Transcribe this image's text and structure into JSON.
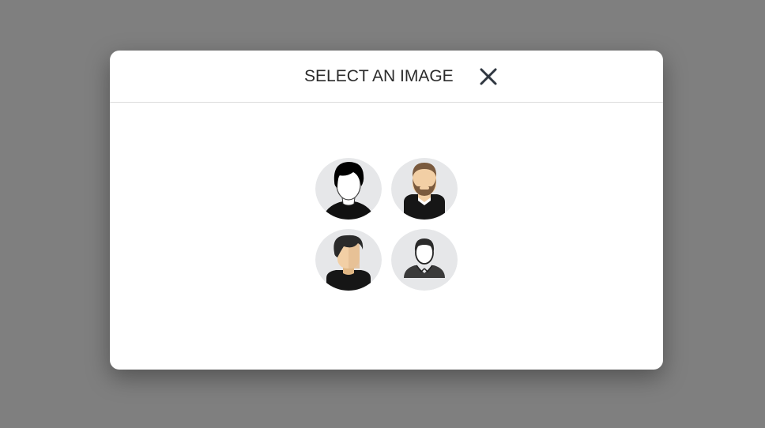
{
  "modal": {
    "title": "SELECT AN IMAGE",
    "close_icon": "close-icon"
  },
  "avatars": [
    {
      "icon": "avatar-man-black-hair-icon"
    },
    {
      "icon": "avatar-man-beard-icon"
    },
    {
      "icon": "avatar-man-fringe-icon"
    },
    {
      "icon": "avatar-man-outline-icon"
    }
  ],
  "colors": {
    "backdrop": "#7f7f7f",
    "modal_bg": "#ffffff",
    "avatar_bg": "#e6e7e9",
    "skin": "#f2cfa5",
    "dark": "#1a1a1a"
  }
}
